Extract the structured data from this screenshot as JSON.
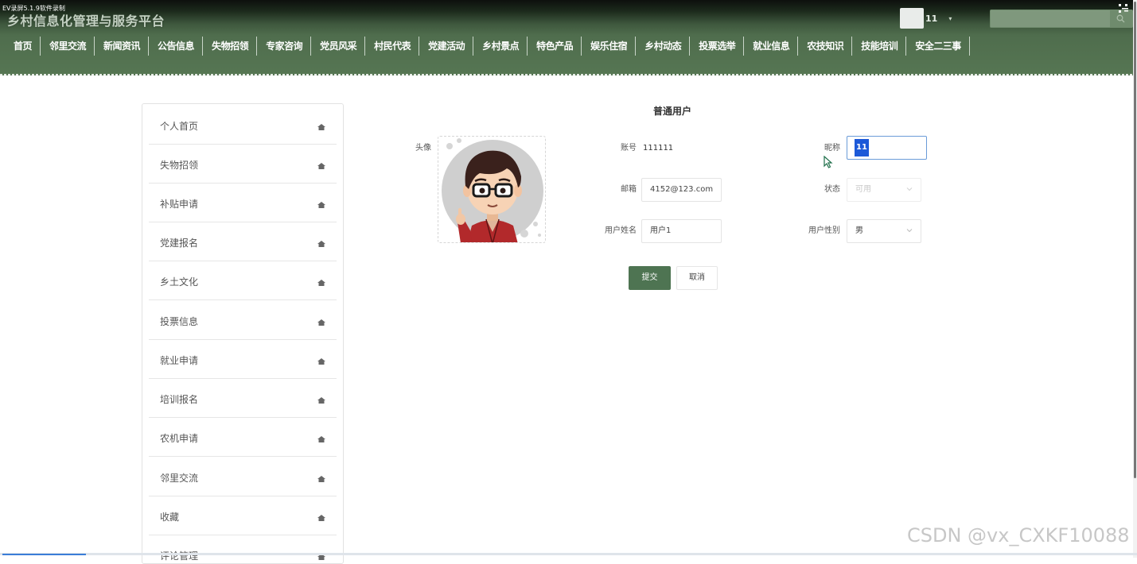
{
  "recorder_label": "EV录屏5.1.9软件录制",
  "header": {
    "site_title": "乡村信息化管理与服务平台",
    "user_name": "11",
    "user_caret": "▾",
    "search_placeholder": "",
    "search_icon": "search-icon",
    "corner_icon": "fullscreen-icon"
  },
  "nav": {
    "items": [
      {
        "label": "首页"
      },
      {
        "label": "邻里交流"
      },
      {
        "label": "新闻资讯"
      },
      {
        "label": "公告信息"
      },
      {
        "label": "失物招领"
      },
      {
        "label": "专家咨询"
      },
      {
        "label": "党员风采"
      },
      {
        "label": "村民代表"
      },
      {
        "label": "党建活动"
      },
      {
        "label": "乡村景点"
      },
      {
        "label": "特色产品"
      },
      {
        "label": "娱乐住宿"
      },
      {
        "label": "乡村动态"
      },
      {
        "label": "投票选举"
      },
      {
        "label": "就业信息"
      },
      {
        "label": "农技知识"
      },
      {
        "label": "技能培训"
      },
      {
        "label": "安全二三事"
      }
    ]
  },
  "sidebar": {
    "items": [
      {
        "label": "个人首页"
      },
      {
        "label": "失物招领"
      },
      {
        "label": "补贴申请"
      },
      {
        "label": "党建报名"
      },
      {
        "label": "乡土文化"
      },
      {
        "label": "投票信息"
      },
      {
        "label": "就业申请"
      },
      {
        "label": "培训报名"
      },
      {
        "label": "农机申请"
      },
      {
        "label": "邻里交流"
      },
      {
        "label": "收藏"
      },
      {
        "label": "评论管理"
      }
    ]
  },
  "form": {
    "section_title": "普通用户",
    "avatar_label": "头像",
    "account_label": "账号",
    "account_value": "111111",
    "nickname_label": "昵称",
    "nickname_value": "11",
    "email_label": "邮箱",
    "email_value": "4152@123.com",
    "status_label": "状态",
    "status_value": "可用",
    "realname_label": "用户姓名",
    "realname_value": "用户1",
    "gender_label": "用户性别",
    "gender_value": "男",
    "submit_label": "提交",
    "cancel_label": "取消"
  },
  "watermark": "CSDN @vx_CXKF10088",
  "colors": {
    "header_green": "#567653",
    "submit_green": "#4e7452",
    "focus_blue": "#6a9bd8",
    "selection_blue": "#1c59d8"
  }
}
